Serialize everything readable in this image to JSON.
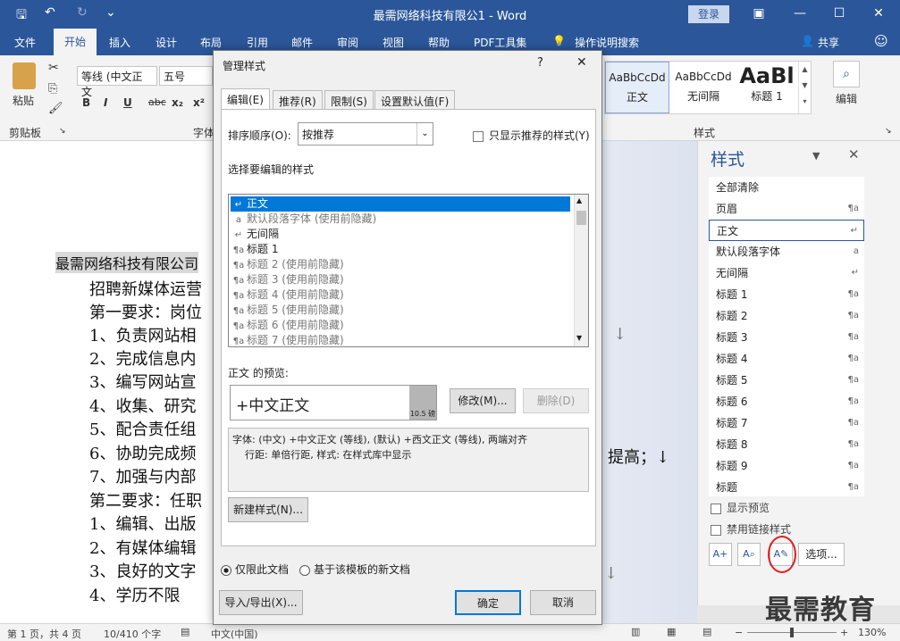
{
  "window": {
    "title": "最需网络科技有限公1 - Word",
    "login": "登录"
  },
  "quick_access": {
    "save": "🖫",
    "undo": "↶",
    "redo": "↻",
    "more": "⌄"
  },
  "ribbon_tabs": [
    "文件",
    "开始",
    "插入",
    "设计",
    "布局",
    "引用",
    "邮件",
    "审阅",
    "视图",
    "帮助",
    "PDF工具集",
    "操作说明搜索"
  ],
  "share": "共享",
  "ribbon": {
    "paste": "粘贴",
    "clipboard": "剪贴板",
    "font_name": "等线 (中文正文",
    "font_size": "五号",
    "font_group": "字体",
    "styles_group": "样式",
    "editing": "编辑",
    "gallery": [
      {
        "sample": "AaBbCcDd",
        "name": "正文"
      },
      {
        "sample": "AaBbCcDd",
        "name": "无间隔"
      },
      {
        "sample": "AaBl",
        "name": "标题 1"
      }
    ]
  },
  "document": {
    "lines": [
      "最需网络科技有限公司",
      "招聘新媒体运营",
      "第一要求：岗位",
      "1、负责网站相",
      "2、完成信息内",
      "3、编写网站宣",
      "4、收集、研究",
      "5、配合责任组",
      "6、协助完成频",
      "7、加强与内部",
      "第二要求：任职",
      "1、编辑、出版",
      "2、有媒体编辑",
      "3、良好的文字",
      "4、学历不限"
    ],
    "right_text": "提高；↓"
  },
  "status": {
    "page": "第 1 页，共 4 页",
    "words": "10/410 个字",
    "lang": "中文(中国)",
    "zoom": "130%"
  },
  "dialog": {
    "title": "管理样式",
    "help": "?",
    "close": "✕",
    "tabs": [
      "编辑(E)",
      "推荐(R)",
      "限制(S)",
      "设置默认值(F)"
    ],
    "sort_label": "排序顺序(O):",
    "sort_value": "按推荐",
    "only_recommended": "只显示推荐的样式(Y)",
    "select_label": "选择要编辑的样式",
    "styles": [
      {
        "g": "↵",
        "name": "正文",
        "selected": true
      },
      {
        "g": "a",
        "name": "默认段落字体  (使用前隐藏)"
      },
      {
        "g": "↵",
        "name": "无间隔"
      },
      {
        "g": "¶a",
        "name": "标题 1"
      },
      {
        "g": "¶a",
        "name": "标题 2  (使用前隐藏)"
      },
      {
        "g": "¶a",
        "name": "标题 3  (使用前隐藏)"
      },
      {
        "g": "¶a",
        "name": "标题 4  (使用前隐藏)"
      },
      {
        "g": "¶a",
        "name": "标题 5  (使用前隐藏)"
      },
      {
        "g": "¶a",
        "name": "标题 6  (使用前隐藏)"
      },
      {
        "g": "¶a",
        "name": "标题 7  (使用前隐藏)"
      }
    ],
    "preview_label": "正文 的预览:",
    "preview_text": "+中文正文",
    "preview_size": "10.5 磅",
    "modify": "修改(M)...",
    "delete": "删除(D)",
    "desc_line1": "字体: (中文) +中文正文 (等线), (默认) +西文正文 (等线), 两端对齐",
    "desc_line2": "行距: 单倍行距, 样式: 在样式库中显示",
    "new_style": "新建样式(N)...",
    "radio_doc": "仅限此文档",
    "radio_template": "基于该模板的新文档",
    "import_export": "导入/导出(X)...",
    "ok": "确定",
    "cancel": "取消"
  },
  "pane": {
    "title": "样式",
    "items": [
      {
        "name": "全部清除",
        "mark": ""
      },
      {
        "name": "页眉",
        "mark": "¶a"
      },
      {
        "name": "正文",
        "mark": "↵",
        "selected": true
      },
      {
        "name": "默认段落字体",
        "mark": "a"
      },
      {
        "name": "无间隔",
        "mark": "↵"
      },
      {
        "name": "标题 1",
        "mark": "¶a"
      },
      {
        "name": "标题 2",
        "mark": "¶a"
      },
      {
        "name": "标题 3",
        "mark": "¶a"
      },
      {
        "name": "标题 4",
        "mark": "¶a"
      },
      {
        "name": "标题 5",
        "mark": "¶a"
      },
      {
        "name": "标题 6",
        "mark": "¶a"
      },
      {
        "name": "标题 7",
        "mark": "¶a"
      },
      {
        "name": "标题 8",
        "mark": "¶a"
      },
      {
        "name": "标题 9",
        "mark": "¶a"
      },
      {
        "name": "标题",
        "mark": "¶a"
      }
    ],
    "show_preview": "显示预览",
    "disable_linked": "禁用链接样式",
    "options": "选项..."
  },
  "watermark": "最需教育"
}
